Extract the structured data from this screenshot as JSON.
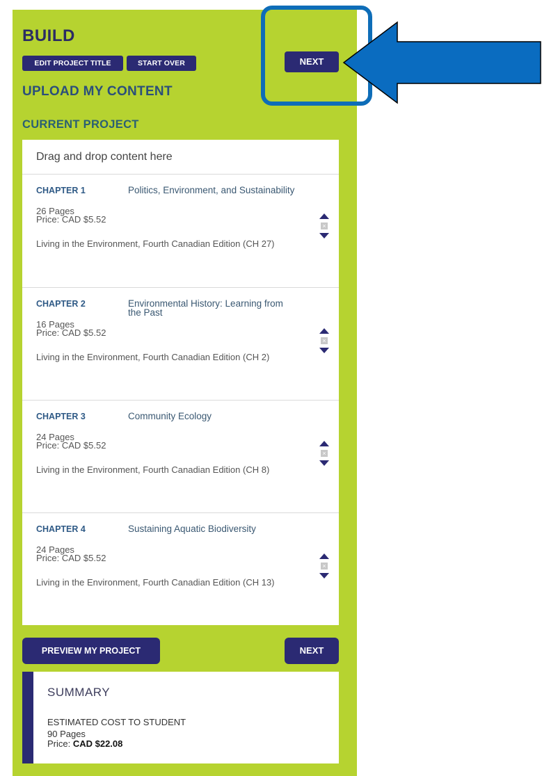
{
  "header": {
    "title": "BUILD",
    "edit_title_label": "EDIT PROJECT TITLE",
    "start_over_label": "START OVER",
    "next_label": "NEXT",
    "upload_heading": "UPLOAD MY CONTENT",
    "current_heading": "CURRENT PROJECT"
  },
  "project": {
    "drop_hint": "Drag and drop content here",
    "chapters": [
      {
        "number": "CHAPTER 1",
        "title": "Politics, Environment, and Sustainability",
        "pages": "26 Pages",
        "price": "Price: CAD $5.52",
        "source": "Living in the Environment, Fourth Canadian Edition (CH 27)"
      },
      {
        "number": "CHAPTER 2",
        "title": "Environmental History: Learning from the Past",
        "pages": "16 Pages",
        "price": "Price: CAD $5.52",
        "source": "Living in the Environment, Fourth Canadian Edition (CH 2)"
      },
      {
        "number": "CHAPTER 3",
        "title": "Community Ecology",
        "pages": "24 Pages",
        "price": "Price: CAD $5.52",
        "source": "Living in the Environment, Fourth Canadian Edition (CH 8)"
      },
      {
        "number": "CHAPTER 4",
        "title": "Sustaining Aquatic Biodiversity",
        "pages": "24 Pages",
        "price": "Price: CAD $5.52",
        "source": "Living in the Environment, Fourth Canadian Edition (CH 13)"
      }
    ]
  },
  "footer": {
    "preview_label": "PREVIEW MY PROJECT",
    "next_label": "NEXT"
  },
  "summary": {
    "title": "SUMMARY",
    "estimate_label": "ESTIMATED COST TO STUDENT",
    "pages": "90 Pages",
    "price_prefix": "Price: ",
    "price_value": "CAD $22.08"
  },
  "colors": {
    "panel": "#b6d330",
    "button": "#2b2a73",
    "highlight": "#0e6db8"
  },
  "icons": [
    "arrow-up-icon",
    "remove-icon",
    "arrow-down-icon",
    "pointer-arrow-icon"
  ]
}
